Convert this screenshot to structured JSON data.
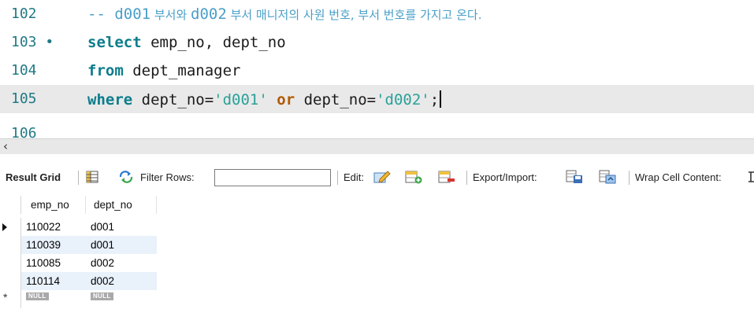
{
  "editor": {
    "lines": [
      {
        "number": "102",
        "comment_prefix": "-- ",
        "comment_code": "d001",
        "comment_text": " 부서와 ",
        "comment_code2": "d002",
        "comment_text2": " 부서 매니저의 사원 번호, 부서 번호를 가지고 온다."
      },
      {
        "number": "103",
        "bullet": "•",
        "kw": "select",
        "text": " emp_no, dept_no"
      },
      {
        "number": "104",
        "kw": "from",
        "text": " dept_manager"
      },
      {
        "number": "105",
        "kw": "where",
        "text_a": " dept_no=",
        "str_a": "'d001'",
        "kw_or": "or",
        "text_b": " dept_no=",
        "str_b": "'d002'",
        "text_c": ";"
      },
      {
        "number": "106"
      }
    ]
  },
  "scrollbar": {
    "left_arrow": "‹"
  },
  "toolbar": {
    "result_grid": "Result Grid",
    "filter_rows": "Filter Rows:",
    "filter_value": "",
    "edit": "Edit:",
    "export_import": "Export/Import:",
    "wrap_cell": "Wrap Cell Content:"
  },
  "grid": {
    "columns": [
      "emp_no",
      "dept_no"
    ],
    "rows": [
      [
        "110022",
        "d001"
      ],
      [
        "110039",
        "d001"
      ],
      [
        "110085",
        "d002"
      ],
      [
        "110114",
        "d002"
      ]
    ],
    "null_label": "NULL"
  }
}
